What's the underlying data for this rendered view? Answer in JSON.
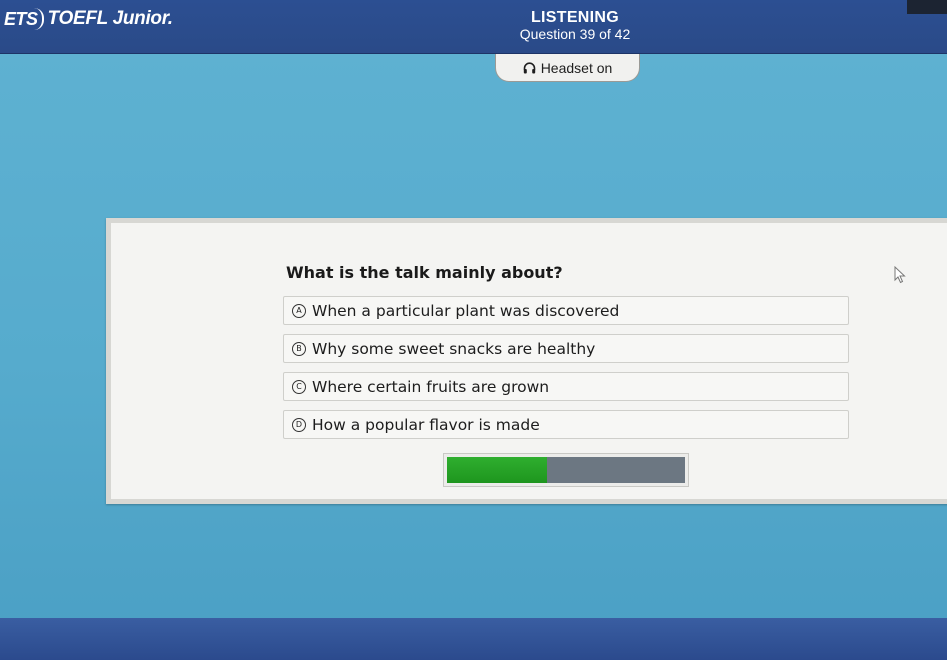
{
  "header": {
    "logo_badge": "ETS",
    "logo_text": "TOEFL Junior.",
    "section": "LISTENING",
    "question_counter": "Question 39 of 42"
  },
  "headset": {
    "icon": "headphones-icon",
    "label": "Headset on"
  },
  "question": {
    "text": "What is the talk mainly about?",
    "options": [
      {
        "letter": "A",
        "text": "When a particular plant was discovered"
      },
      {
        "letter": "B",
        "text": "Why some sweet snacks are healthy"
      },
      {
        "letter": "C",
        "text": "Where certain fruits are grown"
      },
      {
        "letter": "D",
        "text": "How a popular flavor is made"
      }
    ]
  },
  "audio_progress": {
    "fraction": 0.42
  },
  "colors": {
    "header_blue": "#2c4f92",
    "screen_blue": "#5fb2d2",
    "progress_green": "#2fae2f",
    "progress_track": "#6c7782"
  }
}
